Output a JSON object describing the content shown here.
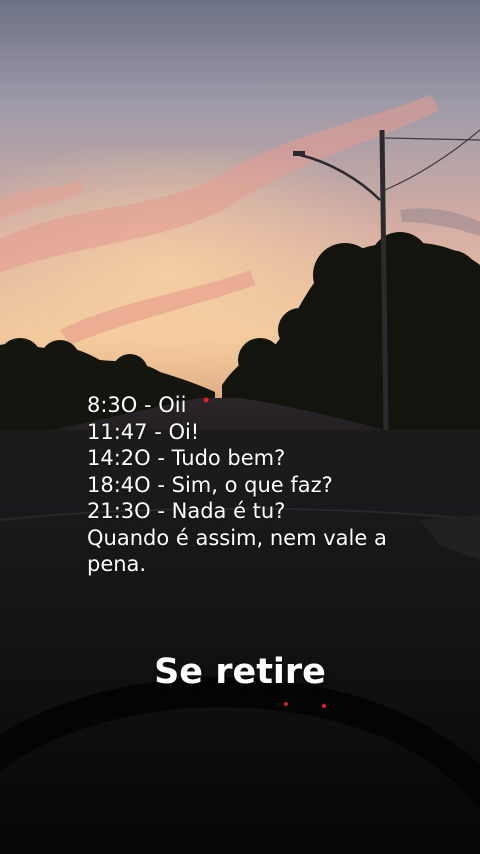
{
  "caption": {
    "lines": [
      "8:3O - Oii",
      "11:47 - Oi!",
      "14:2O - Tudo bem?",
      "18:4O - Sim, o que faz?",
      "21:3O - Nada é tu?"
    ],
    "closing": "Quando é assim, nem vale a pena."
  },
  "overlay_text": "Se retire",
  "colors": {
    "sky_top": "#6f7487",
    "sky_mid": "#c9a2a8",
    "sunset_glow": "#f2c79a",
    "cloud_pink": "#e89a8f",
    "silhouette": "#14140f",
    "dashboard": "#0b0a0c",
    "brake_light": "#e0202a"
  }
}
